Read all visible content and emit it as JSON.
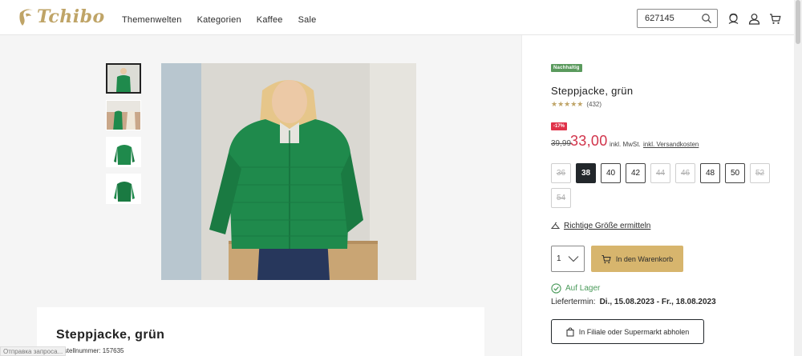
{
  "header": {
    "logo_text": "Tchibo",
    "nav": [
      "Themenwelten",
      "Kategorien",
      "Kaffee",
      "Sale"
    ],
    "search_value": "627145"
  },
  "product": {
    "badge": "Nachhaltig",
    "title": "Steppjacke, grün",
    "rating_count": "(432)",
    "rating": 4.5,
    "discount": "-17%",
    "old_price": "39,99",
    "new_price": "33,00",
    "vat": "inkl. MwSt.",
    "shipping": "inkl. Versandkosten",
    "sizes": [
      {
        "label": "36",
        "state": "disabled"
      },
      {
        "label": "38",
        "state": "selected"
      },
      {
        "label": "40",
        "state": "available"
      },
      {
        "label": "42",
        "state": "available"
      },
      {
        "label": "44",
        "state": "disabled"
      },
      {
        "label": "46",
        "state": "disabled"
      },
      {
        "label": "48",
        "state": "available"
      },
      {
        "label": "50",
        "state": "available"
      },
      {
        "label": "52",
        "state": "disabled"
      },
      {
        "label": "54",
        "state": "disabled"
      }
    ],
    "size_guide": "Richtige Größe ermitteln",
    "quantity": "1",
    "cart_button": "In den Warenkorb",
    "stock": "Auf Lager",
    "delivery_label": "Liefertermin:",
    "delivery_dates": "Di., 15.08.2023 - Fr., 18.08.2023",
    "store_button": "In Filiale oder Supermarkt abholen"
  },
  "details": {
    "title": "Steppjacke, grün",
    "order_number": "Bestellnummer: 157635"
  },
  "status_bar": "Отправка запроса...",
  "colors": {
    "gold": "#bfa467",
    "cart_button": "#d7b56d",
    "price_red": "#d1334a",
    "stock_green": "#4a9a5a",
    "jacket_green": "#1f8a4c"
  }
}
